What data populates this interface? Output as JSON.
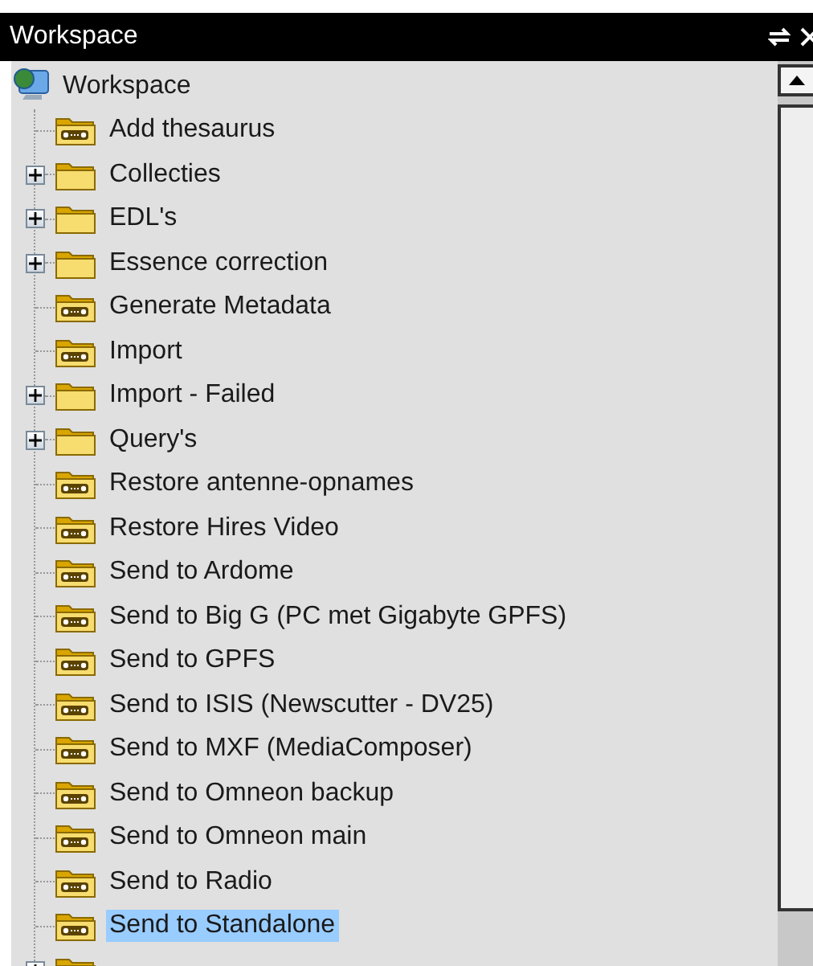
{
  "window": {
    "title": "Workspace"
  },
  "tree": {
    "root": {
      "label": "Workspace"
    },
    "children": [
      {
        "kind": "leaf",
        "label": "Add thesaurus",
        "selected": false
      },
      {
        "kind": "folder",
        "label": "Collecties",
        "expanded": false,
        "selected": false
      },
      {
        "kind": "folder",
        "label": "EDL's",
        "expanded": false,
        "selected": false
      },
      {
        "kind": "folder",
        "label": "Essence correction",
        "expanded": false,
        "selected": false
      },
      {
        "kind": "leaf",
        "label": "Generate Metadata",
        "selected": false
      },
      {
        "kind": "leaf",
        "label": "Import",
        "selected": false
      },
      {
        "kind": "folder",
        "label": "Import - Failed",
        "expanded": false,
        "selected": false
      },
      {
        "kind": "folder",
        "label": "Query's",
        "expanded": false,
        "selected": false
      },
      {
        "kind": "leaf",
        "label": "Restore antenne-opnames",
        "selected": false
      },
      {
        "kind": "leaf",
        "label": "Restore Hires Video",
        "selected": false
      },
      {
        "kind": "leaf",
        "label": "Send to Ardome",
        "selected": false
      },
      {
        "kind": "leaf",
        "label": "Send to Big G (PC met Gigabyte GPFS)",
        "selected": false
      },
      {
        "kind": "leaf",
        "label": "Send to GPFS",
        "selected": false
      },
      {
        "kind": "leaf",
        "label": "Send to ISIS (Newscutter - DV25)",
        "selected": false
      },
      {
        "kind": "leaf",
        "label": "Send to MXF (MediaComposer)",
        "selected": false
      },
      {
        "kind": "leaf",
        "label": "Send to Omneon backup",
        "selected": false
      },
      {
        "kind": "leaf",
        "label": "Send to Omneon main",
        "selected": false
      },
      {
        "kind": "leaf",
        "label": "Send to Radio",
        "selected": false
      },
      {
        "kind": "leaf",
        "label": "Send to Standalone",
        "selected": true
      },
      {
        "kind": "folder",
        "expanded": false,
        "selected": false
      }
    ]
  }
}
